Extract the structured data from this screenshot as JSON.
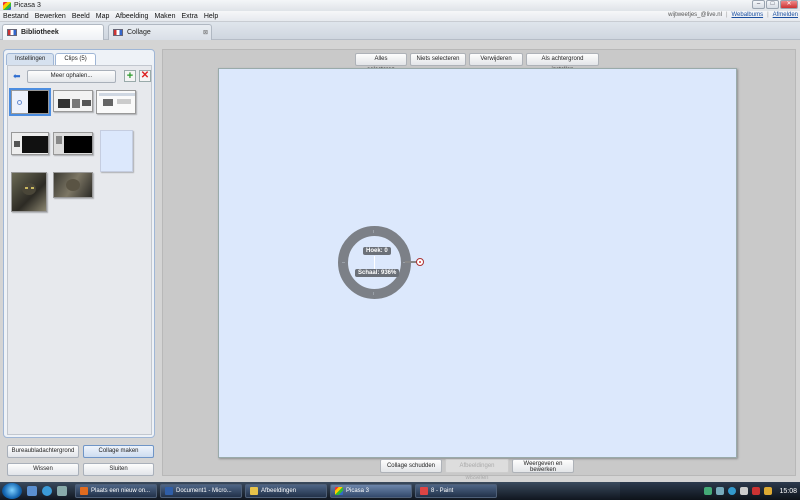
{
  "window": {
    "title": "Picasa 3",
    "controls": [
      "–",
      "□",
      "✕"
    ]
  },
  "menu": {
    "items": [
      "Bestand",
      "Bewerken",
      "Beeld",
      "Map",
      "Afbeelding",
      "Maken",
      "Extra",
      "Help"
    ],
    "user": "wijtweetjes_@live.nl",
    "separator": "|",
    "webalbums": "Webalbums",
    "afmelden": "Afmelden"
  },
  "tabs": [
    {
      "label": "Bibliotheek"
    },
    {
      "label": "Collage",
      "close": "⊠"
    }
  ],
  "left_panel": {
    "subtabs": [
      "Instellingen",
      "Clips (5)"
    ],
    "meer_ophalen": "Meer ophalen...",
    "back_glyph": "⬅",
    "add_glyph": "+",
    "remove_glyph": "✕",
    "buttons": {
      "bureaublad": "Bureaubladachtergrond",
      "collage_maken": "Collage maken",
      "wissen": "Wissen",
      "sluiten": "Sluiten"
    }
  },
  "toolbar": {
    "alles_selecteren": "Alles selecteren",
    "niets_selecteren": "Niets selecteren",
    "verwijderen": "Verwijderen",
    "achtergrond": "Als achtergrond instellen"
  },
  "canvas": {
    "color": "#dce8fc",
    "hook_label": "Hoek: 0",
    "scale_label": "Schaal: 936%"
  },
  "bottom": {
    "schudden": "Collage schudden",
    "wisselen": "Afbeeldingen wisselen",
    "weergeven_line1": "Weergeven en",
    "weergeven_line2": "bewerken"
  },
  "taskbar": {
    "items": [
      "Plaats een nieuw on...",
      "Document1 - Micro...",
      "Afbeeldingen",
      "Picasa 3",
      "8 - Paint"
    ],
    "clock": "15:08"
  }
}
